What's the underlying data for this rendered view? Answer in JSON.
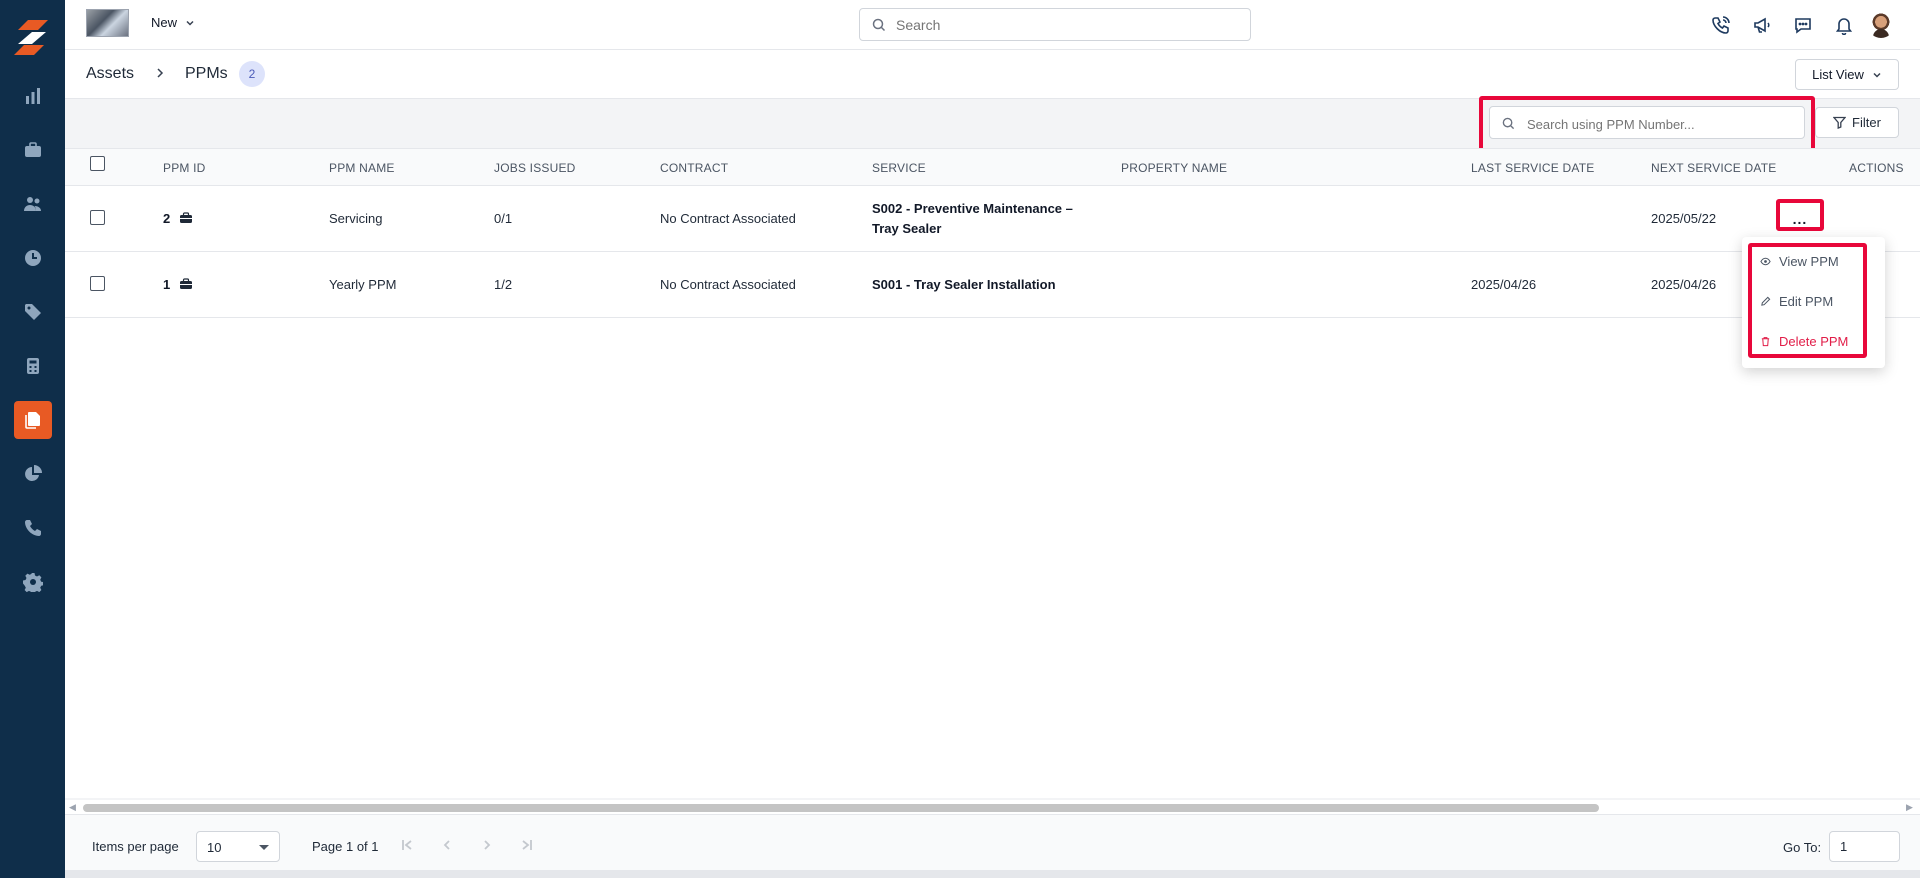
{
  "topbar": {
    "new_label": "New",
    "search_placeholder": "Search"
  },
  "breadcrumb": {
    "parent": "Assets",
    "current": "PPMs",
    "count": "2",
    "view_label": "List View"
  },
  "toolbar": {
    "search_placeholder": "Search using PPM Number...",
    "filter_label": "Filter"
  },
  "table": {
    "headers": {
      "ppm_id": "PPM ID",
      "ppm_name": "PPM NAME",
      "jobs_issued": "JOBS ISSUED",
      "contract": "CONTRACT",
      "service": "SERVICE",
      "property_name": "PROPERTY NAME",
      "last_service_date": "LAST SERVICE DATE",
      "next_service_date": "NEXT SERVICE DATE",
      "actions": "ACTIONS"
    },
    "rows": [
      {
        "ppm_id": "2",
        "ppm_name": "Servicing",
        "jobs_issued": "0/1",
        "contract": "No Contract Associated",
        "service_line1": "S002 - Preventive Maintenance –",
        "service_line2": "Tray Sealer",
        "property_name": "",
        "last_service_date": "",
        "next_service_date": "2025/05/22"
      },
      {
        "ppm_id": "1",
        "ppm_name": "Yearly PPM",
        "jobs_issued": "1/2",
        "contract": "No Contract Associated",
        "service_line1": "S001 - Tray Sealer Installation",
        "service_line2": "",
        "property_name": "",
        "last_service_date": "2025/04/26",
        "next_service_date": "2025/04/26"
      }
    ],
    "actions_label": "..."
  },
  "action_menu": {
    "items": [
      {
        "label": "View PPM",
        "icon": "eye-icon",
        "color": "#4b5563"
      },
      {
        "label": "Edit PPM",
        "icon": "pencil-icon",
        "color": "#4b5563"
      },
      {
        "label": "Delete PPM",
        "icon": "trash-icon",
        "color": "#e11d48"
      }
    ]
  },
  "pagination": {
    "items_per_page_label": "Items per page",
    "items_per_page_value": "10",
    "page_label": "Page 1 of 1",
    "goto_label": "Go To:",
    "goto_value": "1"
  },
  "colors": {
    "sidebar": "#0f2e4a",
    "accent": "#e85a24",
    "highlight": "#e8073a",
    "danger": "#e11d48"
  }
}
